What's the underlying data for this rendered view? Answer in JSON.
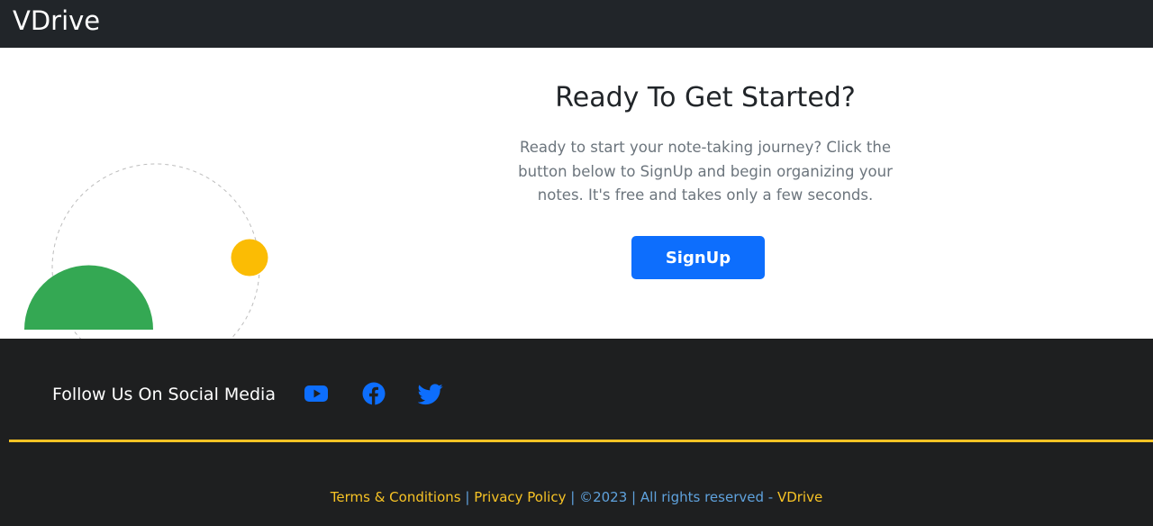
{
  "navbar": {
    "brand": "VDrive"
  },
  "hero": {
    "title": "Ready To Get Started?",
    "description": "Ready to start your note-taking journey? Click the button below to SignUp and begin organizing your notes. It's free and takes only a few seconds.",
    "button_label": "SignUp"
  },
  "footer": {
    "social_label": "Follow Us On Social Media",
    "social_icons": [
      "youtube-icon",
      "facebook-icon",
      "twitter-icon"
    ],
    "links": {
      "terms": "Terms & Conditions",
      "separator": "|",
      "privacy": "Privacy Policy",
      "copyright": "©2023",
      "rights": "All rights reserved -",
      "brand": "VDrive"
    }
  },
  "colors": {
    "navbar_bg": "#212529",
    "primary_button": "#0d6efd",
    "accent_yellow": "#f7c325",
    "shape_green": "#34a853",
    "shape_yellow": "#fbbc04",
    "footer_bg": "#1e1f20",
    "footer_text_blue": "#5fa2dd"
  }
}
